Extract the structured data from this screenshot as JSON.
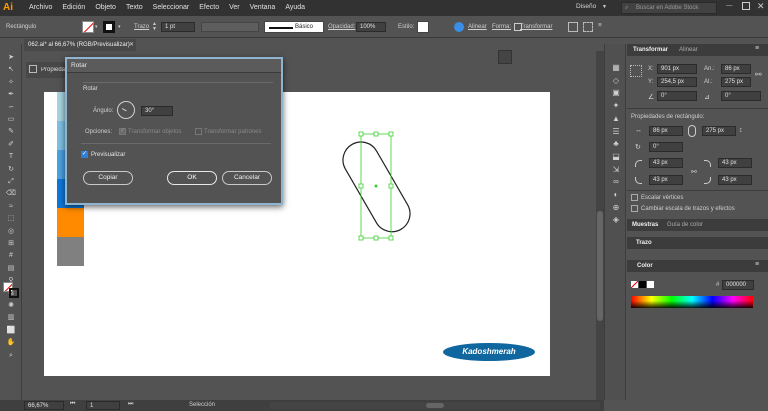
{
  "app": {
    "logo": "Ai"
  },
  "menubar": {
    "items": [
      "Archivo",
      "Edición",
      "Objeto",
      "Texto",
      "Seleccionar",
      "Efecto",
      "Ver",
      "Ventana",
      "Ayuda"
    ],
    "workspace": "Diseño",
    "search_placeholder": "Buscar en Adobe Stock"
  },
  "controlbar": {
    "object_type": "Rectángulo",
    "stroke_label": "Trazo",
    "stroke_value": "1 pt",
    "brush_value": "Básico",
    "opacity_label": "Opacidad:",
    "opacity_value": "100%",
    "style_label": "Estilo:",
    "align_label": "Alinear",
    "shape_label": "Forma:",
    "transform_label": "Transformar"
  },
  "document": {
    "tab_title": "062.ai* al 66,67% (RGB/Previsualizar)",
    "props_tab": "Propiedades"
  },
  "swatches_on_canvas": [
    "#a9d3e0",
    "#7ec0e2",
    "#4aa2e0",
    "#0f77d8",
    "#ff8a00",
    "#808080"
  ],
  "shape": {
    "rotation_deg": 30
  },
  "watermark": {
    "text": "Kadoshmerah"
  },
  "rotate_dialog": {
    "title": "Rotar",
    "section": "Rotar",
    "angle_label": "Ángulo:",
    "angle_value": "30°",
    "options_label": "Opciones:",
    "transform_objects": "Transformar objetos",
    "transform_patterns": "Transformar patrones",
    "preview_label": "Previsualizar",
    "preview_checked": true,
    "copy_button": "Copiar",
    "ok_button": "OK",
    "cancel_button": "Cancelar"
  },
  "transform_panel": {
    "tab_active": "Transformar",
    "tab_inactive": "Alinear",
    "x_label": "X:",
    "x_value": "901 px",
    "w_label": "An.:",
    "w_value": "86 px",
    "y_label": "Y:",
    "y_value": "254,5 px",
    "h_label": "Al.:",
    "h_value": "275 px",
    "angle1_value": "0°",
    "angle2_value": "0°",
    "rect_props_title": "Propiedades de rectángulo:",
    "rect_w_value": "86 px",
    "rect_h_value": "275 px",
    "rect_angle_value": "0°",
    "corner_values": [
      "43 px",
      "43 px",
      "43 px",
      "43 px"
    ],
    "scale_corners": "Escalar vértices",
    "scale_strokes": "Cambiar escala de trazos y efectos"
  },
  "lower_panels": {
    "swatches_tab": "Muestras",
    "color_guide_tab": "Guía de color",
    "stroke_tab": "Trazo",
    "color_tab": "Color",
    "hex_value": "000000"
  },
  "statusbar": {
    "zoom": "66,67%",
    "artboard": "1",
    "mode": "Selección"
  }
}
